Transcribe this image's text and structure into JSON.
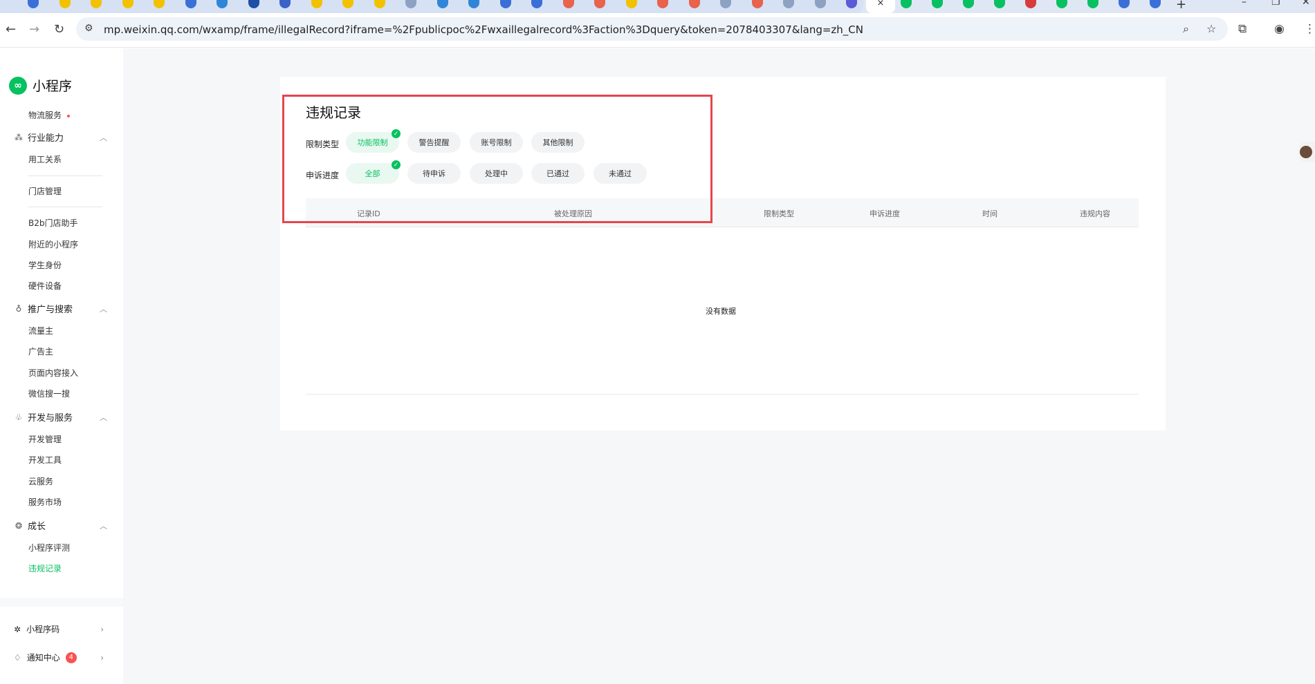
{
  "browser": {
    "url": "mp.weixin.qq.com/wxamp/frame/illegalRecord?iframe=%2Fpublicpoc%2Fwxaillegalrecord%3Faction%3Dquery&token=2078403307&lang=zh_CN",
    "close_tab_glyph": "×",
    "new_tab_glyph": "+",
    "tab_favicon_colors": [
      "#3b6fd8",
      "#f2c200",
      "#f2c200",
      "#f2c200",
      "#f2c200",
      "#3b6fd8",
      "#2f86d8",
      "#1e4fa8",
      "#3a63c9",
      "#f2c200",
      "#f2c200",
      "#f2c200",
      "#8da2c2",
      "#2f86d8",
      "#2f86d8",
      "#3b6fd8",
      "#3b6fd8",
      "#e8624c",
      "#e8624c",
      "#f2c200",
      "#e8624c",
      "#e8624c",
      "#8da2c2",
      "#e8624c",
      "#8da2c2",
      "#8da2c2",
      "#5b5bd8"
    ],
    "right_tab_favicon_colors": [
      "#07c160",
      "#07c160",
      "#07c160",
      "#07c160",
      "#d83b3b",
      "#07c160",
      "#07c160",
      "#3b6fd8",
      "#3b6fd8"
    ]
  },
  "sidebar": {
    "brand": "小程序",
    "items_top": [
      {
        "label": "物流服务",
        "dot": true
      }
    ],
    "groups": [
      {
        "label": "行业能力",
        "icon": "industry-icon",
        "items": [
          "用工关系"
        ]
      },
      {
        "label": "推广与搜索",
        "icon": "promotion-icon",
        "items": [
          "流量主",
          "广告主",
          "页面内容接入",
          "微信搜一搜"
        ]
      },
      {
        "label": "开发与服务",
        "icon": "dev-icon",
        "items": [
          "开发管理",
          "开发工具",
          "云服务",
          "服务市场"
        ]
      },
      {
        "label": "成长",
        "icon": "growth-icon",
        "items": [
          "小程序评测",
          "违规记录"
        ]
      }
    ],
    "ungrouped_items": [
      "门店管理",
      "B2b门店助手",
      "附近的小程序",
      "学生身份",
      "硬件设备"
    ],
    "footer": {
      "qrcode_label": "小程序码",
      "notice_label": "通知中心",
      "notice_count": "4"
    }
  },
  "page": {
    "title": "违规记录",
    "filter_type_label": "限制类型",
    "filter_type_options": [
      "功能限制",
      "警告提醒",
      "账号限制",
      "其他限制"
    ],
    "filter_type_selected": "功能限制",
    "filter_progress_label": "申诉进度",
    "filter_progress_options": [
      "全部",
      "待申诉",
      "处理中",
      "已通过",
      "未通过"
    ],
    "filter_progress_selected": "全部",
    "table_headers": [
      "记录ID",
      "被处理原因",
      "限制类型",
      "申诉进度",
      "时间",
      "违规内容"
    ],
    "empty_text": "没有数据"
  },
  "colors": {
    "accent": "#07c160",
    "highlight_border": "#e8444c",
    "badge": "#fa5151"
  }
}
